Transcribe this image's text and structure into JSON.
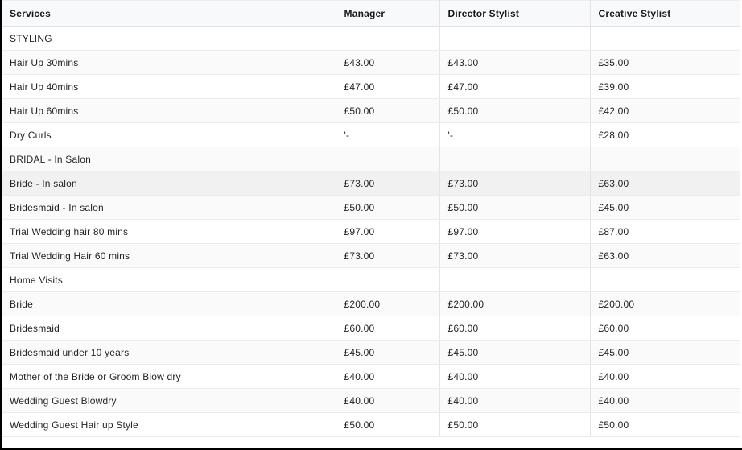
{
  "table": {
    "columns": [
      "Services",
      "Manager",
      "Director Stylist",
      "Creative Stylist"
    ],
    "rows": [
      {
        "service": "STYLING",
        "manager": "",
        "director": "",
        "creative": "",
        "section": true
      },
      {
        "service": "Hair Up 30mins",
        "manager": "£43.00",
        "director": "£43.00",
        "creative": "£35.00"
      },
      {
        "service": "Hair Up 40mins",
        "manager": "£47.00",
        "director": "£47.00",
        "creative": "£39.00"
      },
      {
        "service": "Hair Up 60mins",
        "manager": "£50.00",
        "director": "£50.00",
        "creative": "£42.00"
      },
      {
        "service": "Dry Curls",
        "manager": "'-",
        "director": "'-",
        "creative": "£28.00"
      },
      {
        "service": "BRIDAL - In Salon",
        "manager": "",
        "director": "",
        "creative": "",
        "section": true
      },
      {
        "service": "Bride - In salon",
        "manager": "£73.00",
        "director": "£73.00",
        "creative": "£63.00",
        "highlight": true
      },
      {
        "service": "Bridesmaid - In salon",
        "manager": "£50.00",
        "director": "£50.00",
        "creative": "£45.00"
      },
      {
        "service": "Trial Wedding hair 80 mins",
        "manager": "£97.00",
        "director": "£97.00",
        "creative": "£87.00"
      },
      {
        "service": "Trial Wedding Hair 60 mins",
        "manager": "£73.00",
        "director": "£73.00",
        "creative": "£63.00"
      },
      {
        "service": "Home Visits",
        "manager": "",
        "director": "",
        "creative": "",
        "section": true
      },
      {
        "service": "Bride",
        "manager": "£200.00",
        "director": "£200.00",
        "creative": "£200.00"
      },
      {
        "service": "Bridesmaid",
        "manager": "£60.00",
        "director": "£60.00",
        "creative": "£60.00"
      },
      {
        "service": "Bridesmaid under 10 years",
        "manager": "£45.00",
        "director": "£45.00",
        "creative": "£45.00"
      },
      {
        "service": "Mother of the Bride or Groom Blow dry",
        "manager": "£40.00",
        "director": "£40.00",
        "creative": "£40.00"
      },
      {
        "service": "Wedding Guest Blowdry",
        "manager": "£40.00",
        "director": "£40.00",
        "creative": "£40.00"
      },
      {
        "service": "Wedding Guest Hair up Style",
        "manager": "£50.00",
        "director": "£50.00",
        "creative": "£50.00"
      }
    ]
  },
  "colors": {
    "header_bg": "#f8f9fa",
    "zebra_row_bg": "#fafafa",
    "highlight_row_bg": "#f1f1f1",
    "text": "#212529",
    "edge_border": "#000000"
  }
}
